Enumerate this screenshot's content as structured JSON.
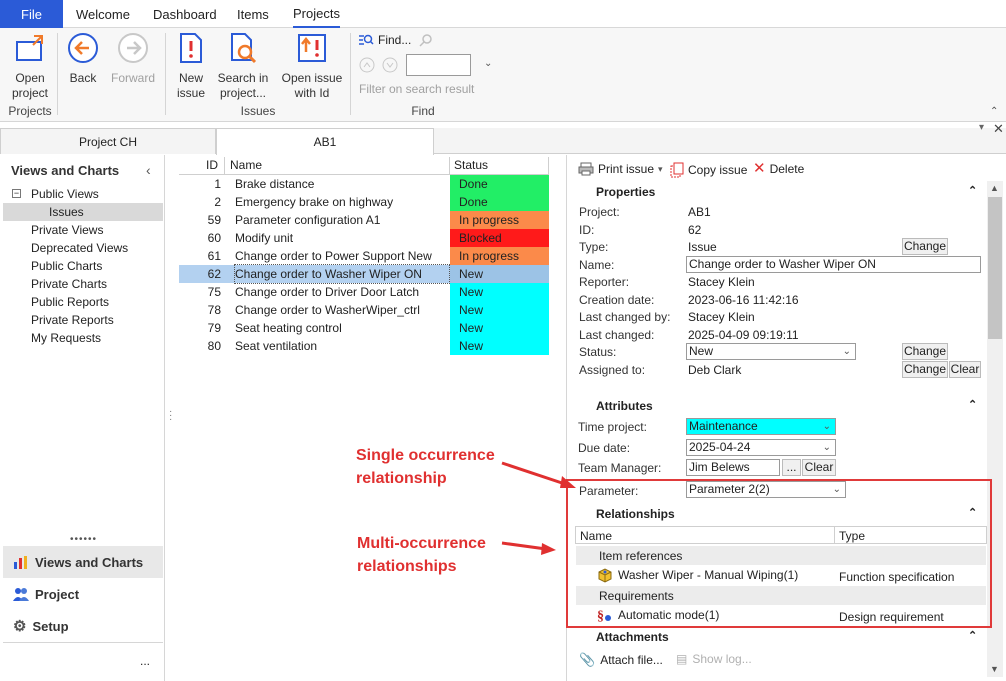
{
  "menu": {
    "file": "File",
    "tabs": [
      "Welcome",
      "Dashboard",
      "Items",
      "Projects"
    ]
  },
  "ribbon": {
    "open_project": "Open project",
    "back": "Back",
    "forward": "Forward",
    "new_issue": "New issue",
    "search_in_project": "Search in project...",
    "open_issue_with_id": "Open issue with Id",
    "find": "Find...",
    "filter_on_search": "Filter on search result",
    "groups": {
      "projects": "Projects",
      "issues": "Issues",
      "find": "Find"
    }
  },
  "doc_tabs": [
    "Project CH",
    "AB1"
  ],
  "left_panel": {
    "title": "Views and Charts",
    "tree": [
      "Public Views",
      "Issues",
      "Private Views",
      "Deprecated Views",
      "Public Charts",
      "Private Charts",
      "Public Reports",
      "Private Reports",
      "My Requests"
    ],
    "nav": [
      "Views and Charts",
      "Project",
      "Setup"
    ],
    "more": "..."
  },
  "grid": {
    "headers": {
      "id": "ID",
      "name": "Name",
      "status": "Status"
    },
    "rows": [
      {
        "id": "1",
        "name": "Brake distance",
        "status": "Done",
        "color": "#22ee66"
      },
      {
        "id": "2",
        "name": "Emergency brake on highway",
        "status": "Done",
        "color": "#22ee66"
      },
      {
        "id": "59",
        "name": "Parameter configuration A1",
        "status": "In progress",
        "color": "#fb8a4a"
      },
      {
        "id": "60",
        "name": "Modify unit",
        "status": "Blocked",
        "color": "#ff1a1a"
      },
      {
        "id": "61",
        "name": "Change order to Power Support New",
        "status": "In progress",
        "color": "#fb8a4a"
      },
      {
        "id": "62",
        "name": "Change order to Washer Wiper ON",
        "status": "New",
        "color": "#9cc3e6"
      },
      {
        "id": "75",
        "name": "Change order to Driver Door Latch",
        "status": "New",
        "color": "#00ffff"
      },
      {
        "id": "78",
        "name": "Change order to WasherWiper_ctrl",
        "status": "New",
        "color": "#00ffff"
      },
      {
        "id": "79",
        "name": "Seat heating control",
        "status": "New",
        "color": "#00ffff"
      },
      {
        "id": "80",
        "name": "Seat ventilation",
        "status": "New",
        "color": "#00ffff"
      }
    ]
  },
  "issue_toolbar": {
    "print": "Print issue",
    "copy": "Copy issue",
    "delete": "Delete"
  },
  "properties": {
    "title": "Properties",
    "project_label": "Project:",
    "project": "AB1",
    "id_label": "ID:",
    "id": "62",
    "type_label": "Type:",
    "type": "Issue",
    "name_label": "Name:",
    "name": "Change order to Washer Wiper ON",
    "reporter_label": "Reporter:",
    "reporter": "Stacey Klein",
    "created_label": "Creation date:",
    "created": "2023-06-16 11:42:16",
    "changed_by_label": "Last changed by:",
    "changed_by": "Stacey Klein",
    "changed_label": "Last changed:",
    "changed": "2025-04-09 09:19:11",
    "status_label": "Status:",
    "status": "New",
    "assigned_label": "Assigned to:",
    "assigned": "Deb Clark",
    "change": "Change",
    "clear": "Clear"
  },
  "attributes": {
    "title": "Attributes",
    "time_project_label": "Time project:",
    "time_project": "Maintenance",
    "due_label": "Due date:",
    "due": "2025-04-24",
    "team_manager_label": "Team Manager:",
    "team_manager": "Jim Belews",
    "parameter_label": "Parameter:",
    "parameter": "Parameter 2(2)",
    "dots": "...",
    "clear": "Clear"
  },
  "relationships": {
    "title": "Relationships",
    "col_name": "Name",
    "col_type": "Type",
    "groups": [
      {
        "label": "Item references",
        "item": "Washer Wiper - Manual Wiping(1)",
        "type": "Function specification"
      },
      {
        "label": "Requirements",
        "item": "Automatic mode(1)",
        "type": "Design requirement"
      }
    ]
  },
  "attachments": {
    "title": "Attachments",
    "attach": "Attach file...",
    "show_log": "Show log..."
  },
  "annotations": {
    "single": "Single occurrence relationship",
    "multi": "Multi-occurrence relationships"
  },
  "colors": {
    "accent": "#2b5bd7",
    "annotation": "#e03030",
    "cyan_field": "#00ffff"
  }
}
